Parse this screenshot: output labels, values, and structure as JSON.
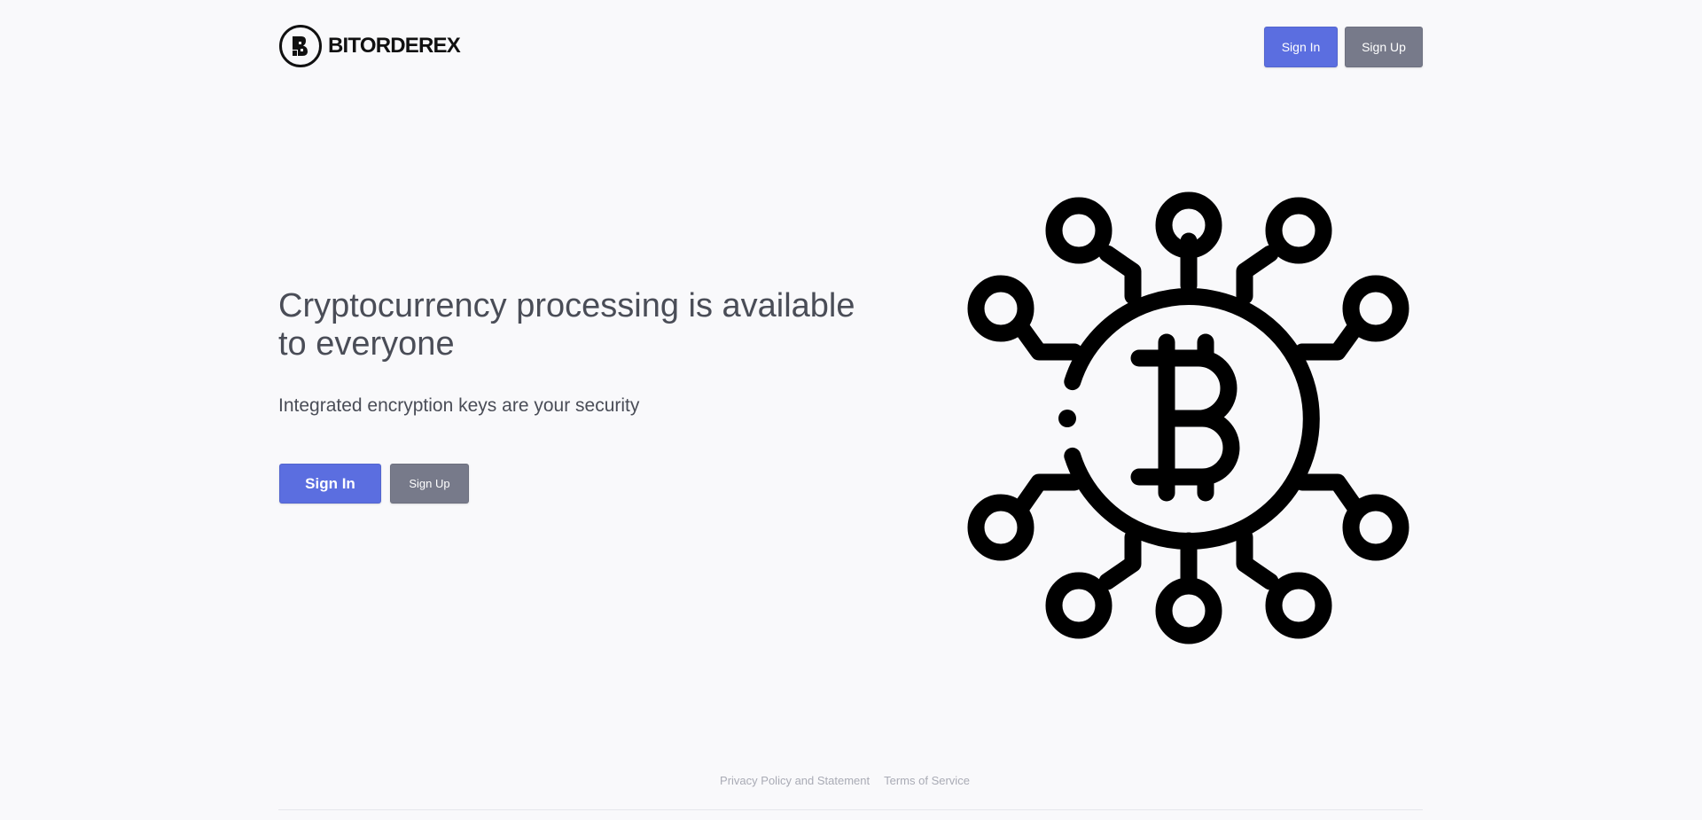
{
  "header": {
    "brand_name": "BITORDEREX",
    "signin_label": "Sign In",
    "signup_label": "Sign Up"
  },
  "hero": {
    "title": "Cryptocurrency processing is available to everyone",
    "subtitle": "Integrated encryption keys are your security",
    "signin_label": "Sign In",
    "signup_label": "Sign Up",
    "illustration_icon": "bitcoin-network-icon"
  },
  "footer": {
    "privacy_label": "Privacy Policy and Statement",
    "terms_label": "Terms of Service"
  },
  "colors": {
    "background": "#f9f9fb",
    "primary_button": "#5b6ee0",
    "secondary_button": "#777a8a",
    "heading_text": "#4a4d57",
    "footer_text": "#a9abb5"
  }
}
